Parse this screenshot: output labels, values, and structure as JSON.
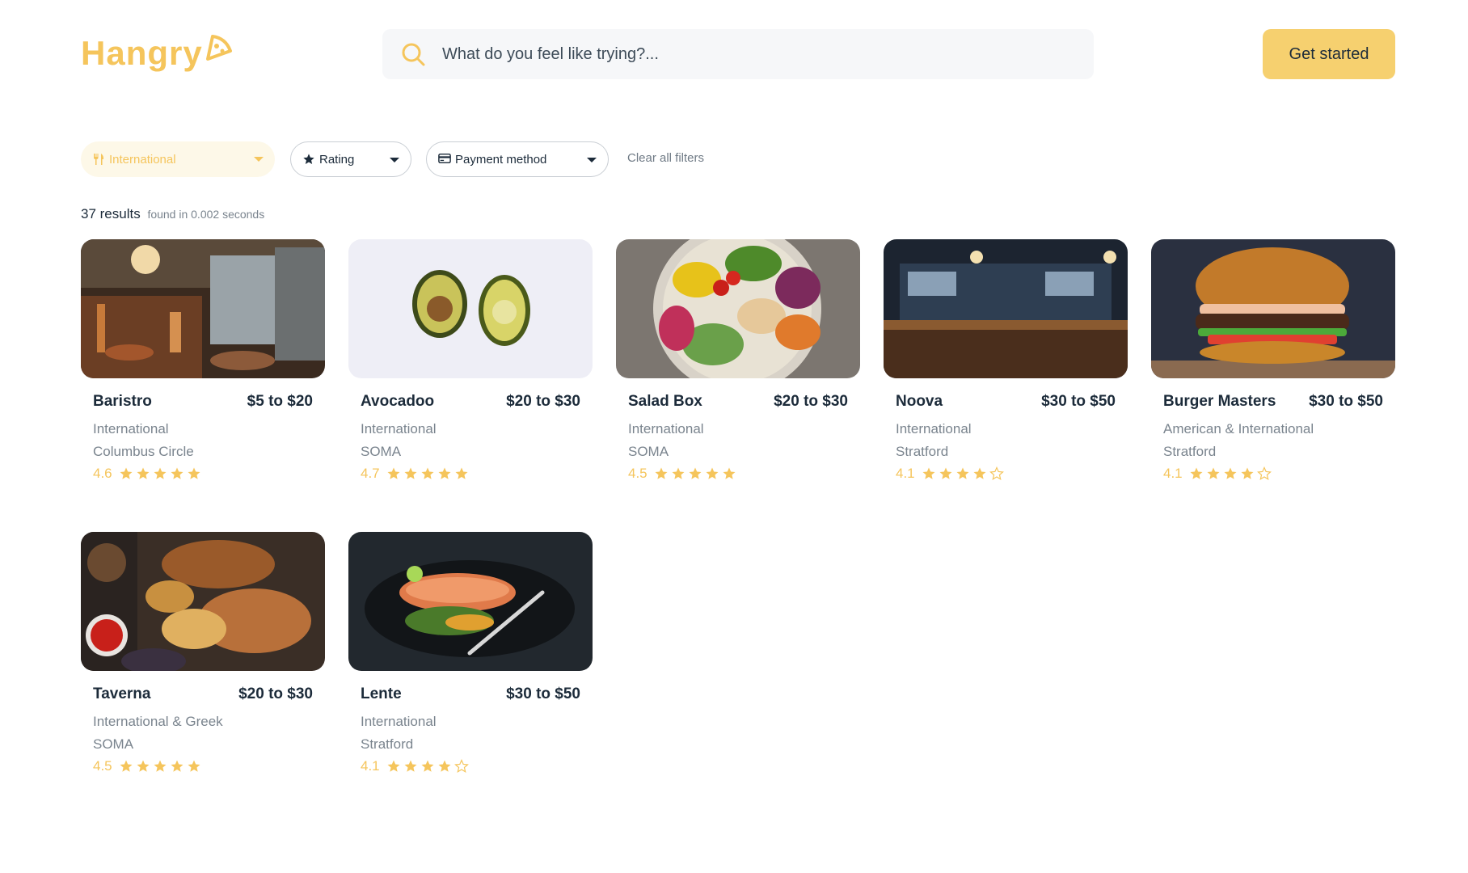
{
  "header": {
    "logo_text": "Hangry",
    "search_placeholder": "What do you feel like trying?...",
    "cta_label": "Get started"
  },
  "filters": {
    "cuisine": {
      "label": "International",
      "icon": "utensils-icon"
    },
    "rating": {
      "label": "Rating",
      "icon": "star-icon"
    },
    "payment": {
      "label": "Payment method",
      "icon": "credit-card-icon"
    },
    "clear_label": "Clear all filters"
  },
  "results": {
    "count": "37 results",
    "time": "found in 0.002 seconds"
  },
  "colors": {
    "accent": "#f5c55c",
    "button": "#f6d06f",
    "text": "#1c2b3a",
    "muted": "#7a848e"
  },
  "restaurants": [
    {
      "name": "Baristro",
      "price": "$5 to $20",
      "cuisine": "International",
      "location": "Columbus Circle",
      "rating": "4.6",
      "stars": 5,
      "image": "restaurant-interior"
    },
    {
      "name": "Avocadoo",
      "price": "$20 to $30",
      "cuisine": "International",
      "location": "SOMA",
      "rating": "4.7",
      "stars": 5,
      "image": "avocado-halves"
    },
    {
      "name": "Salad Box",
      "price": "$20 to $30",
      "cuisine": "International",
      "location": "SOMA",
      "rating": "4.5",
      "stars": 5,
      "image": "salad-bowl"
    },
    {
      "name": "Noova",
      "price": "$30 to $50",
      "cuisine": "International",
      "location": "Stratford",
      "rating": "4.1",
      "stars": 4,
      "image": "bar-interior"
    },
    {
      "name": "Burger Masters",
      "price": "$30 to $50",
      "cuisine": "American & International",
      "location": "Stratford",
      "rating": "4.1",
      "stars": 4,
      "image": "burger"
    },
    {
      "name": "Taverna",
      "price": "$20 to $30",
      "cuisine": "International & Greek",
      "location": "SOMA",
      "rating": "4.5",
      "stars": 5,
      "image": "grilled-meat"
    },
    {
      "name": "Lente",
      "price": "$30 to $50",
      "cuisine": "International",
      "location": "Stratford",
      "rating": "4.1",
      "stars": 4,
      "image": "salmon-plate"
    }
  ]
}
